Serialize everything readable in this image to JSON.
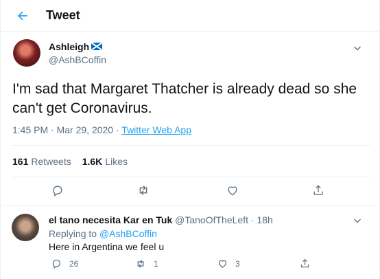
{
  "header": {
    "title": "Tweet"
  },
  "tweet": {
    "author_name": "Ashleigh",
    "author_handle": "@AshBCoffin",
    "text": "I'm sad that Margaret Thatcher is already dead so she can't get Coronavirus.",
    "time": "1:45 PM",
    "date": "Mar 29, 2020",
    "source": "Twitter Web App",
    "retweets_count": "161",
    "retweets_label": "Retweets",
    "likes_count": "1.6K",
    "likes_label": "Likes"
  },
  "reply": {
    "author_name": "el tano necesita Kar en Tuk",
    "author_handle": "@TanoOfTheLeft",
    "time": "18h",
    "replying_prefix": "Replying to",
    "replying_to": "@AshBCoffin",
    "text": "Here in Argentina we feel u",
    "reply_count": "26",
    "retweet_count": "1",
    "like_count": "3"
  },
  "icons": {
    "back": "arrow-left-icon",
    "flag": "scotland-flag-icon",
    "caret": "chevron-down-icon",
    "reply": "speech-bubble-icon",
    "retweet": "retweet-icon",
    "like": "heart-icon",
    "share": "share-icon"
  },
  "colors": {
    "accent": "#1da1f2",
    "text": "#0f1419",
    "muted": "#5b7083",
    "border": "#ebeef0"
  }
}
